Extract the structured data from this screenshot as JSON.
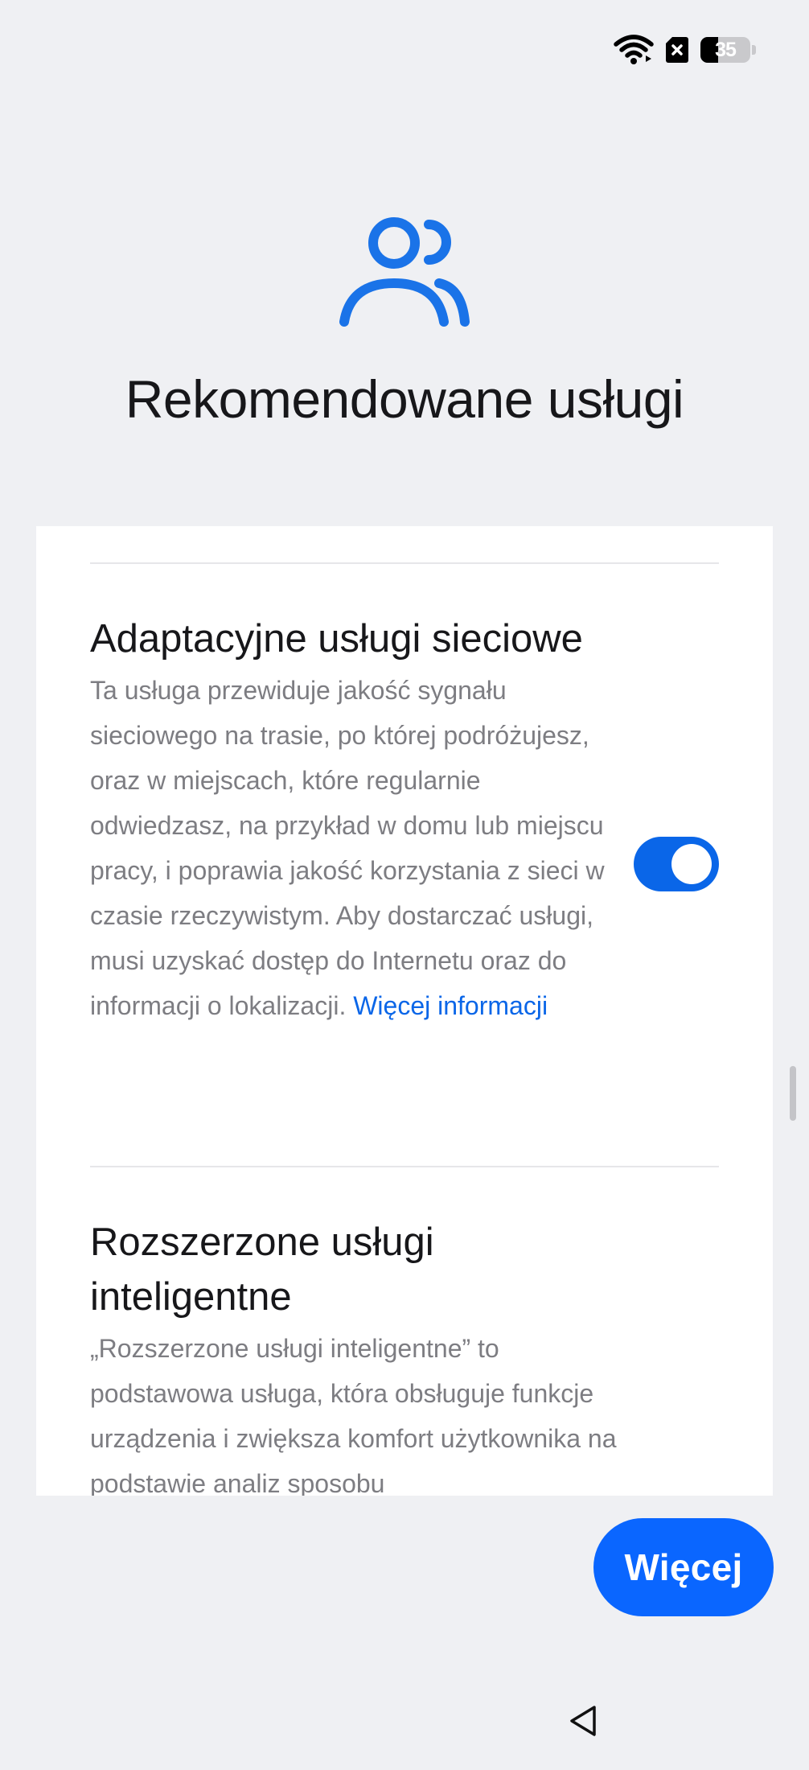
{
  "status_bar": {
    "battery_level": "35",
    "battery_fraction": 0.35,
    "icons": [
      "wifi-icon",
      "no-sim-icon",
      "battery-icon"
    ]
  },
  "header": {
    "icon": "people-icon",
    "title": "Rekomendowane usługi"
  },
  "settings": [
    {
      "title": "Adaptacyjne usługi sieciowe",
      "description": "Ta usługa przewiduje jakość sygnału sieciowego na trasie, po której podróżujesz, oraz w miejscach, które regularnie odwiedzasz, na przykład w domu lub miejscu pracy, i poprawia jakość korzystania z sieci w czasie rzeczywistym. Aby dostarczać usługi, musi uzyskać dostęp do Internetu oraz do informacji o lokalizacji.",
      "link": "Więcej informacji",
      "enabled": true
    },
    {
      "title": "Rozszerzone usługi inteligentne",
      "description": "„Rozszerzone usługi inteligentne” to podstawowa usługa, która obsługuje funkcje urządzenia i zwiększa komfort użytkownika na podstawie analiz sposobu"
    }
  ],
  "more_button": {
    "label": "Więcej"
  },
  "navigation": {
    "back_icon": "back-triangle-icon"
  },
  "colors": {
    "accent": "#0a66e8",
    "button": "#0a66ff",
    "background": "#eff0f3",
    "card": "#ffffff"
  }
}
